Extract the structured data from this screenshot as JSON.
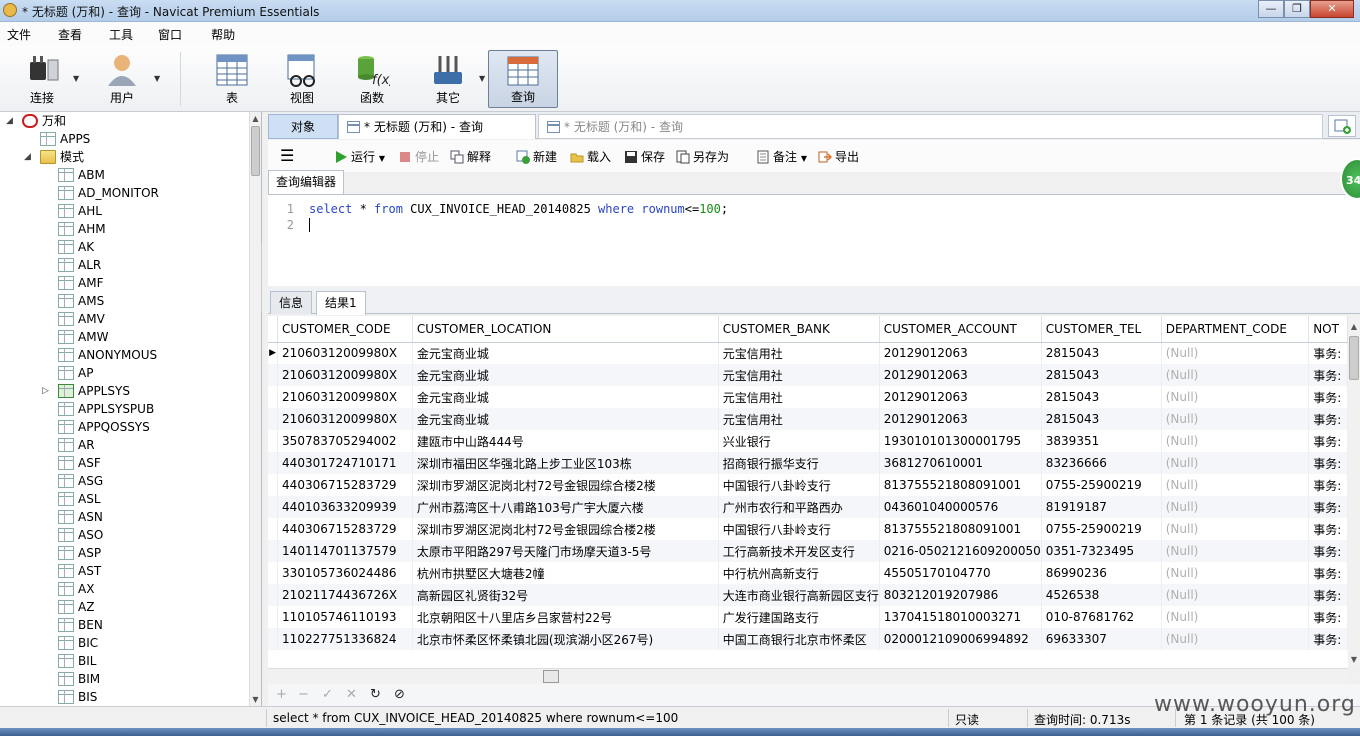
{
  "window": {
    "title": "* 无标题 (万和) - 查询 - Navicat Premium Essentials",
    "controls": [
      "—",
      "❐",
      "✕"
    ]
  },
  "menu": [
    "文件",
    "查看",
    "工具",
    "窗口",
    "帮助"
  ],
  "toolbar": {
    "connect": "连接",
    "user": "用户",
    "table": "表",
    "view": "视图",
    "function": "函数",
    "other": "其它",
    "query": "查询",
    "fx": "f(x)"
  },
  "tree": {
    "connection": "万和",
    "apps": "APPS",
    "schemas": "模式",
    "items": [
      "ABM",
      "AD_MONITOR",
      "AHL",
      "AHM",
      "AK",
      "ALR",
      "AMF",
      "AMS",
      "AMV",
      "AMW",
      "ANONYMOUS",
      "AP",
      "APPLSYS",
      "APPLSYSPUB",
      "APPQOSSYS",
      "AR",
      "ASF",
      "ASG",
      "ASL",
      "ASN",
      "ASO",
      "ASP",
      "AST",
      "AX",
      "AZ",
      "BEN",
      "BIC",
      "BIL",
      "BIM",
      "BIS"
    ]
  },
  "tabs": {
    "objects": "对象",
    "active_query": "* 无标题 (万和) - 查询",
    "inactive_query": "* 无标题 (万和) - 查询"
  },
  "query_toolbar": {
    "run": "运行",
    "stop": "停止",
    "explain": "解释",
    "new": "新建",
    "load": "载入",
    "save": "保存",
    "save_as": "另存为",
    "memo": "备注",
    "export": "导出"
  },
  "editor": {
    "tab": "查询编辑器",
    "line_numbers": [
      "1",
      "2"
    ],
    "sql": {
      "kw_select": "select",
      "star": " * ",
      "kw_from": "from",
      "table": " CUX_INVOICE_HEAD_20140825 ",
      "kw_where": "where",
      "col": "rownum",
      "op": "<=",
      "val": "100",
      "end": ";"
    }
  },
  "result_tabs": {
    "info": "信息",
    "result": "结果1"
  },
  "grid": {
    "columns": [
      "CUSTOMER_CODE",
      "CUSTOMER_LOCATION",
      "CUSTOMER_BANK",
      "CUSTOMER_ACCOUNT",
      "CUSTOMER_TEL",
      "DEPARTMENT_CODE",
      "NOT"
    ],
    "rows": [
      [
        "21060312009980X",
        "金元宝商业城",
        "元宝信用社",
        "20129012063",
        "2815043",
        "(Null)",
        "事务:"
      ],
      [
        "21060312009980X",
        "金元宝商业城",
        "元宝信用社",
        "20129012063",
        "2815043",
        "(Null)",
        "事务:"
      ],
      [
        "21060312009980X",
        "金元宝商业城",
        "元宝信用社",
        "20129012063",
        "2815043",
        "(Null)",
        "事务:"
      ],
      [
        "21060312009980X",
        "金元宝商业城",
        "元宝信用社",
        "20129012063",
        "2815043",
        "(Null)",
        "事务:"
      ],
      [
        "350783705294002",
        "建瓯市中山路444号",
        "兴业银行",
        "193010101300001795",
        "3839351",
        "(Null)",
        "事务:"
      ],
      [
        "440301724710171",
        "深圳市福田区华强北路上步工业区103栋",
        "招商银行振华支行",
        "3681270610001",
        "83236666",
        "(Null)",
        "事务:"
      ],
      [
        "440306715283729",
        "深圳市罗湖区泥岗北村72号金银园综合楼2楼",
        "中国银行八卦岭支行",
        "813755521808091001",
        "0755-25900219",
        "(Null)",
        "事务:"
      ],
      [
        "440103633209939",
        "广州市荔湾区十八甫路103号广宇大厦六楼",
        "广州市农行和平路西办",
        "043601040000576",
        "81919187",
        "(Null)",
        "事务:"
      ],
      [
        "440306715283729",
        "深圳市罗湖区泥岗北村72号金银园综合楼2楼",
        "中国银行八卦岭支行",
        "813755521808091001",
        "0755-25900219",
        "(Null)",
        "事务:"
      ],
      [
        "140114701137579",
        "太原市平阳路297号天隆门市场摩天道3-5号",
        "工行高新技术开发区支行",
        "0216-0502121609200050",
        "0351-7323495",
        "(Null)",
        "事务:"
      ],
      [
        "330105736024486",
        "杭州市拱墅区大塘巷2幢",
        "中行杭州高新支行",
        "45505170104770",
        "86990236",
        "(Null)",
        "事务:"
      ],
      [
        "21021174436726X",
        "高新园区礼贤街32号",
        "大连市商业银行高新园区支行",
        "803212019207986",
        "4526538",
        "(Null)",
        "事务:"
      ],
      [
        "110105746110193",
        "北京朝阳区十八里店乡吕家营村22号",
        "广发行建国路支行",
        "137041518010003271",
        "010-87681762",
        "(Null)",
        "事务:"
      ],
      [
        "110227751336824",
        "北京市怀柔区怀柔镇北园(现滨湖小区267号)",
        "中国工商银行北京市怀柔区",
        "0200012109006994892",
        "69633307",
        "(Null)",
        "事务:"
      ]
    ]
  },
  "nav": [
    "+",
    "−",
    "✓",
    "✕",
    "↻",
    "⊘"
  ],
  "status": {
    "sql": "select * from CUX_INVOICE_HEAD_20140825 where rownum<=100",
    "readonly": "只读",
    "query_time": "查询时间: 0.713s",
    "records": "第 1 条记录 (共 100 条)"
  },
  "watermark": "www.wooyun.org",
  "badge": "34",
  "colors": {
    "keyword": "#2a46c8",
    "number": "#1a8a1a",
    "null": "#b0b0b0",
    "connection_red": "#c91e1e"
  }
}
